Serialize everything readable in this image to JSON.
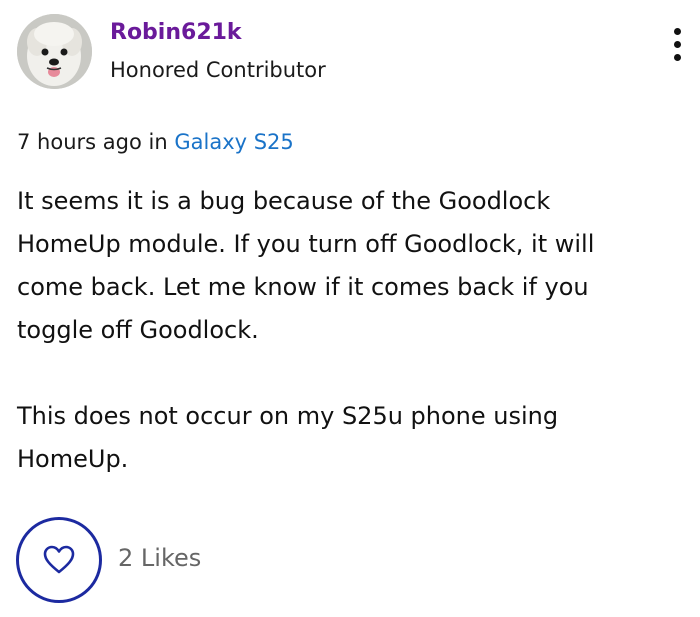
{
  "author": {
    "name": "Robin621k",
    "rank": "Honored Contributor",
    "avatar_icon": "dog-avatar"
  },
  "meta": {
    "time": "7 hours ago",
    "in_label": "in",
    "board": "Galaxy S25"
  },
  "post": {
    "paragraphs": [
      "It seems it is a bug because of the Goodlock HomeUp module. If you turn off Goodlock, it will come back. Let me know if it comes back if you toggle off Goodlock.",
      "This does not occur on my S25u phone using HomeUp."
    ]
  },
  "actions": {
    "like_icon": "heart-icon",
    "likes_label": "2 Likes",
    "menu_icon": "more-vertical-icon"
  },
  "colors": {
    "author_name": "#6a1a9a",
    "link": "#1a73c8",
    "like_ring": "#1c2aa0",
    "muted": "#666666"
  }
}
